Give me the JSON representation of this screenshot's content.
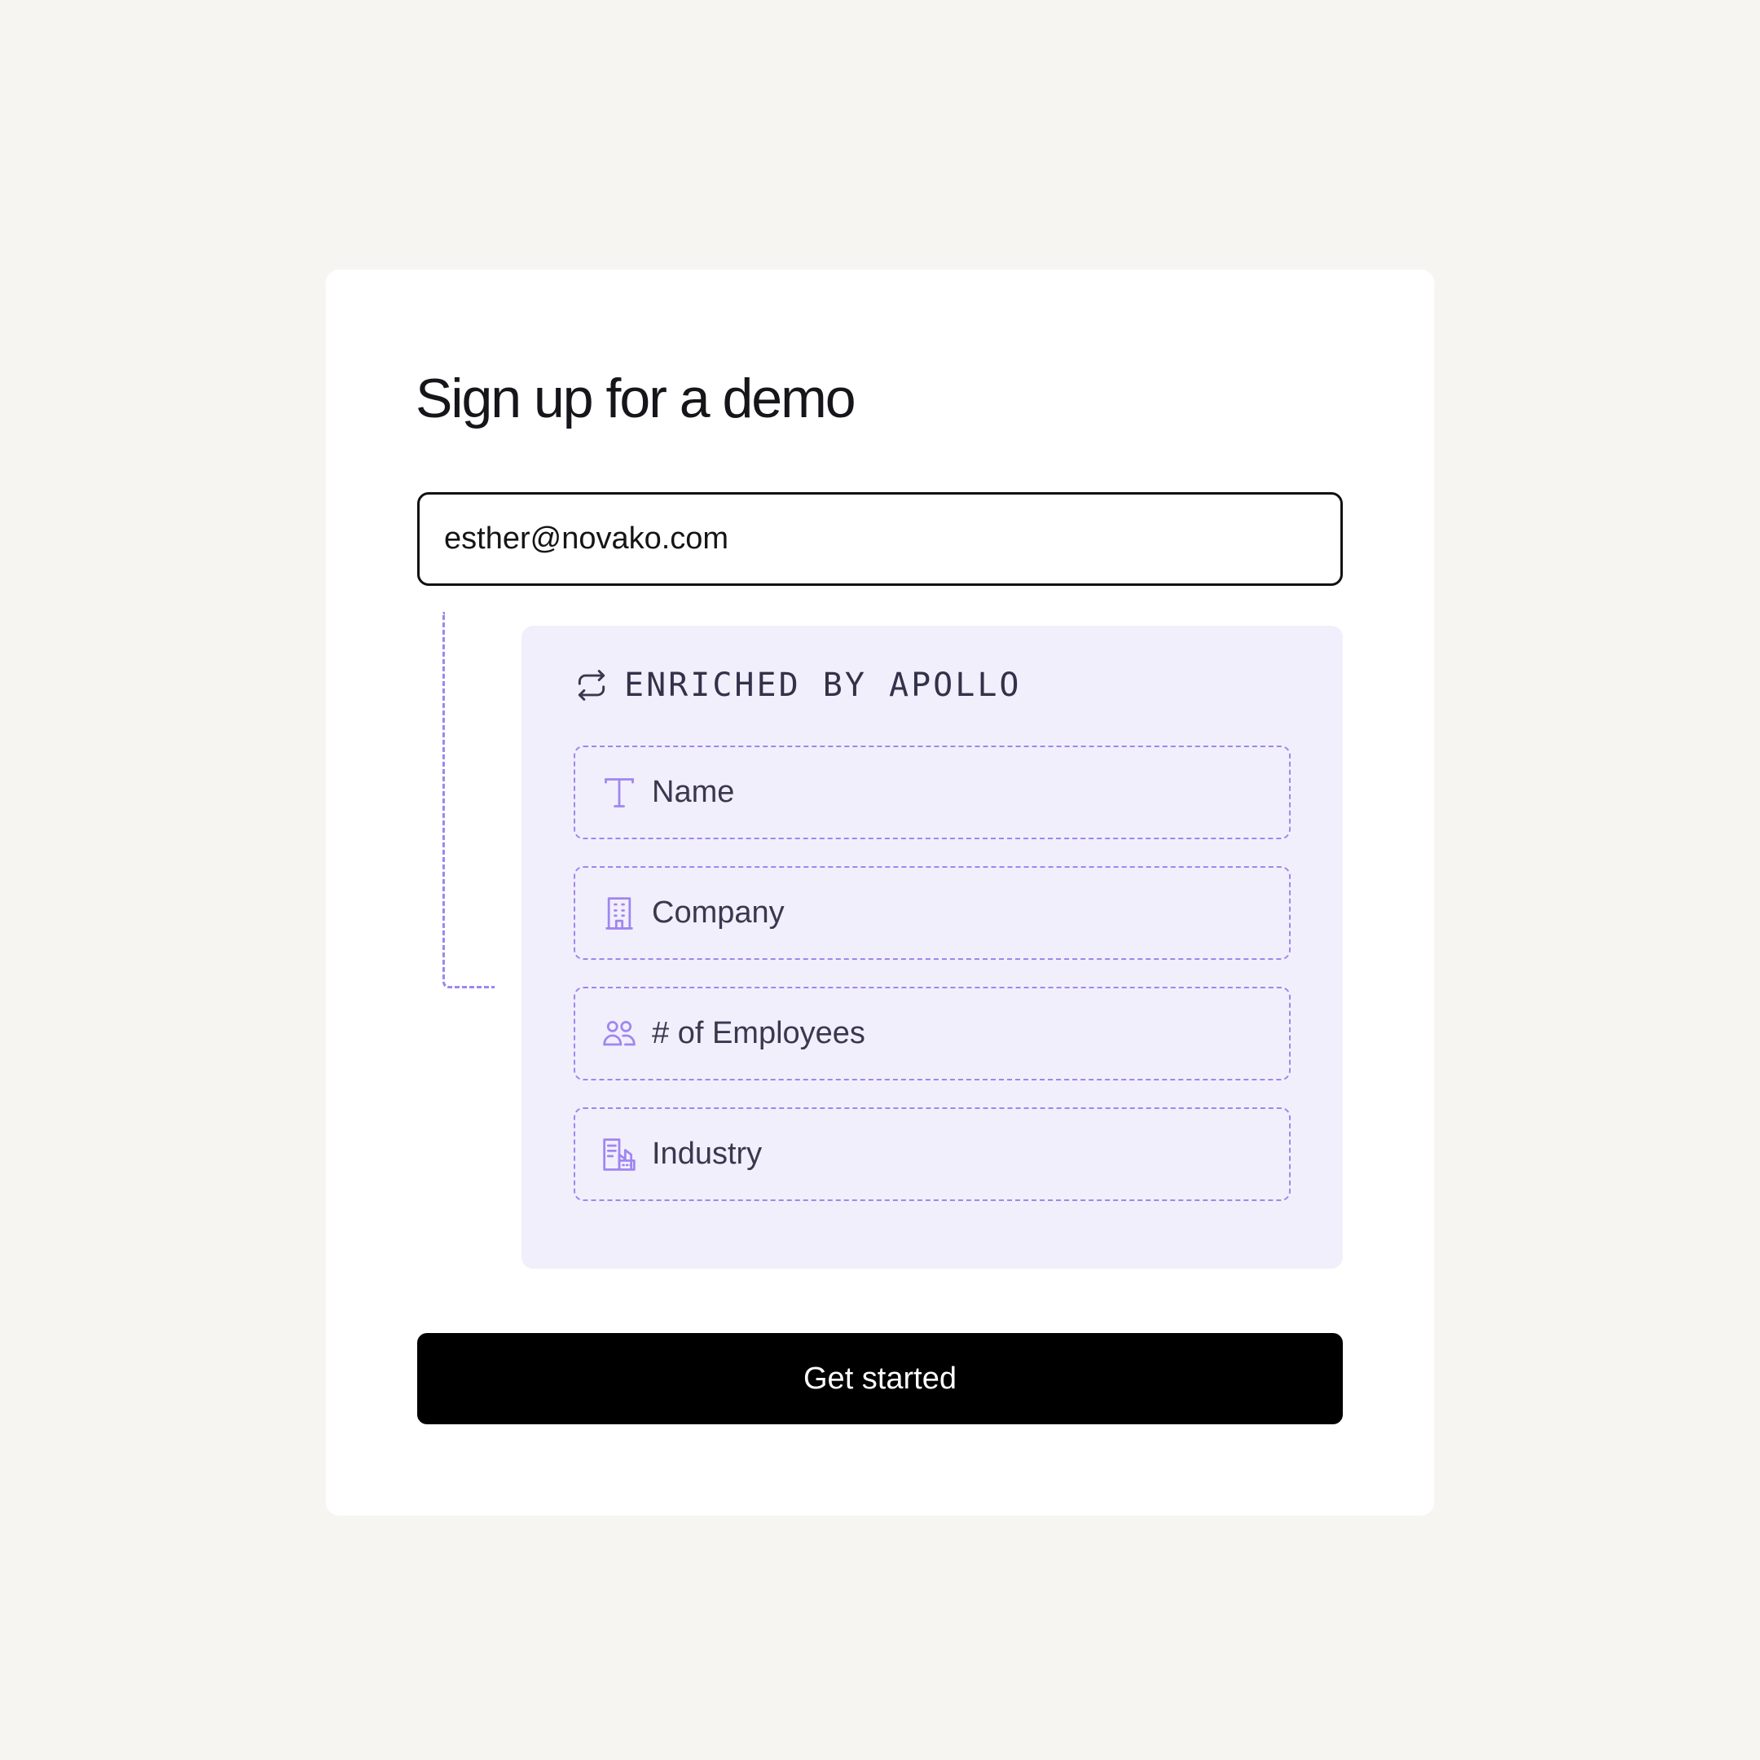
{
  "form": {
    "title": "Sign up for a demo",
    "email_value": "esther@novako.com",
    "submit_label": "Get started"
  },
  "enrichment": {
    "header_label": "ENRICHED BY APOLLO",
    "header_icon": "refresh-icon",
    "fields": [
      {
        "label": "Name",
        "icon": "text-icon"
      },
      {
        "label": "Company",
        "icon": "building-icon"
      },
      {
        "label": "# of Employees",
        "icon": "users-icon"
      },
      {
        "label": "Industry",
        "icon": "factory-icon"
      }
    ]
  },
  "colors": {
    "page_background": "#f6f5f2",
    "card_background": "#ffffff",
    "panel_background": "#f2effc",
    "accent": "#9f86f0",
    "button_background": "#000000",
    "button_text": "#ffffff"
  }
}
